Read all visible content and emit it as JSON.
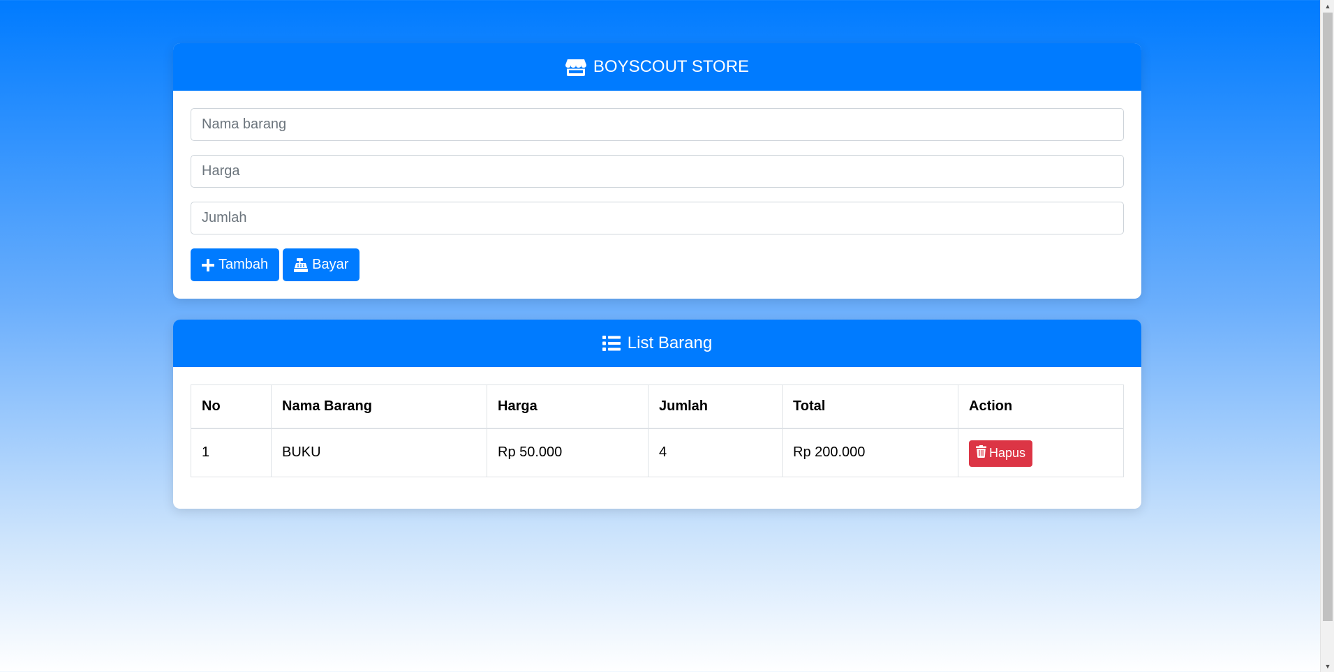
{
  "store": {
    "title": "BOYSCOUT STORE",
    "icon": "store-icon",
    "inputs": {
      "nama_placeholder": "Nama barang",
      "harga_placeholder": "Harga",
      "jumlah_placeholder": "Jumlah"
    },
    "buttons": {
      "tambah_label": "Tambah",
      "tambah_icon": "plus-icon",
      "bayar_label": "Bayar",
      "bayar_icon": "cash-register-icon"
    }
  },
  "list": {
    "title": "List Barang",
    "icon": "list-icon",
    "columns": [
      "No",
      "Nama Barang",
      "Harga",
      "Jumlah",
      "Total",
      "Action"
    ],
    "rows": [
      {
        "no": "1",
        "nama": "BUKU",
        "harga": "Rp 50.000",
        "jumlah": "4",
        "total": "Rp 200.000",
        "action_label": "Hapus",
        "action_icon": "trash-icon"
      }
    ]
  },
  "colors": {
    "primary": "#007bff",
    "danger": "#dc3545"
  }
}
